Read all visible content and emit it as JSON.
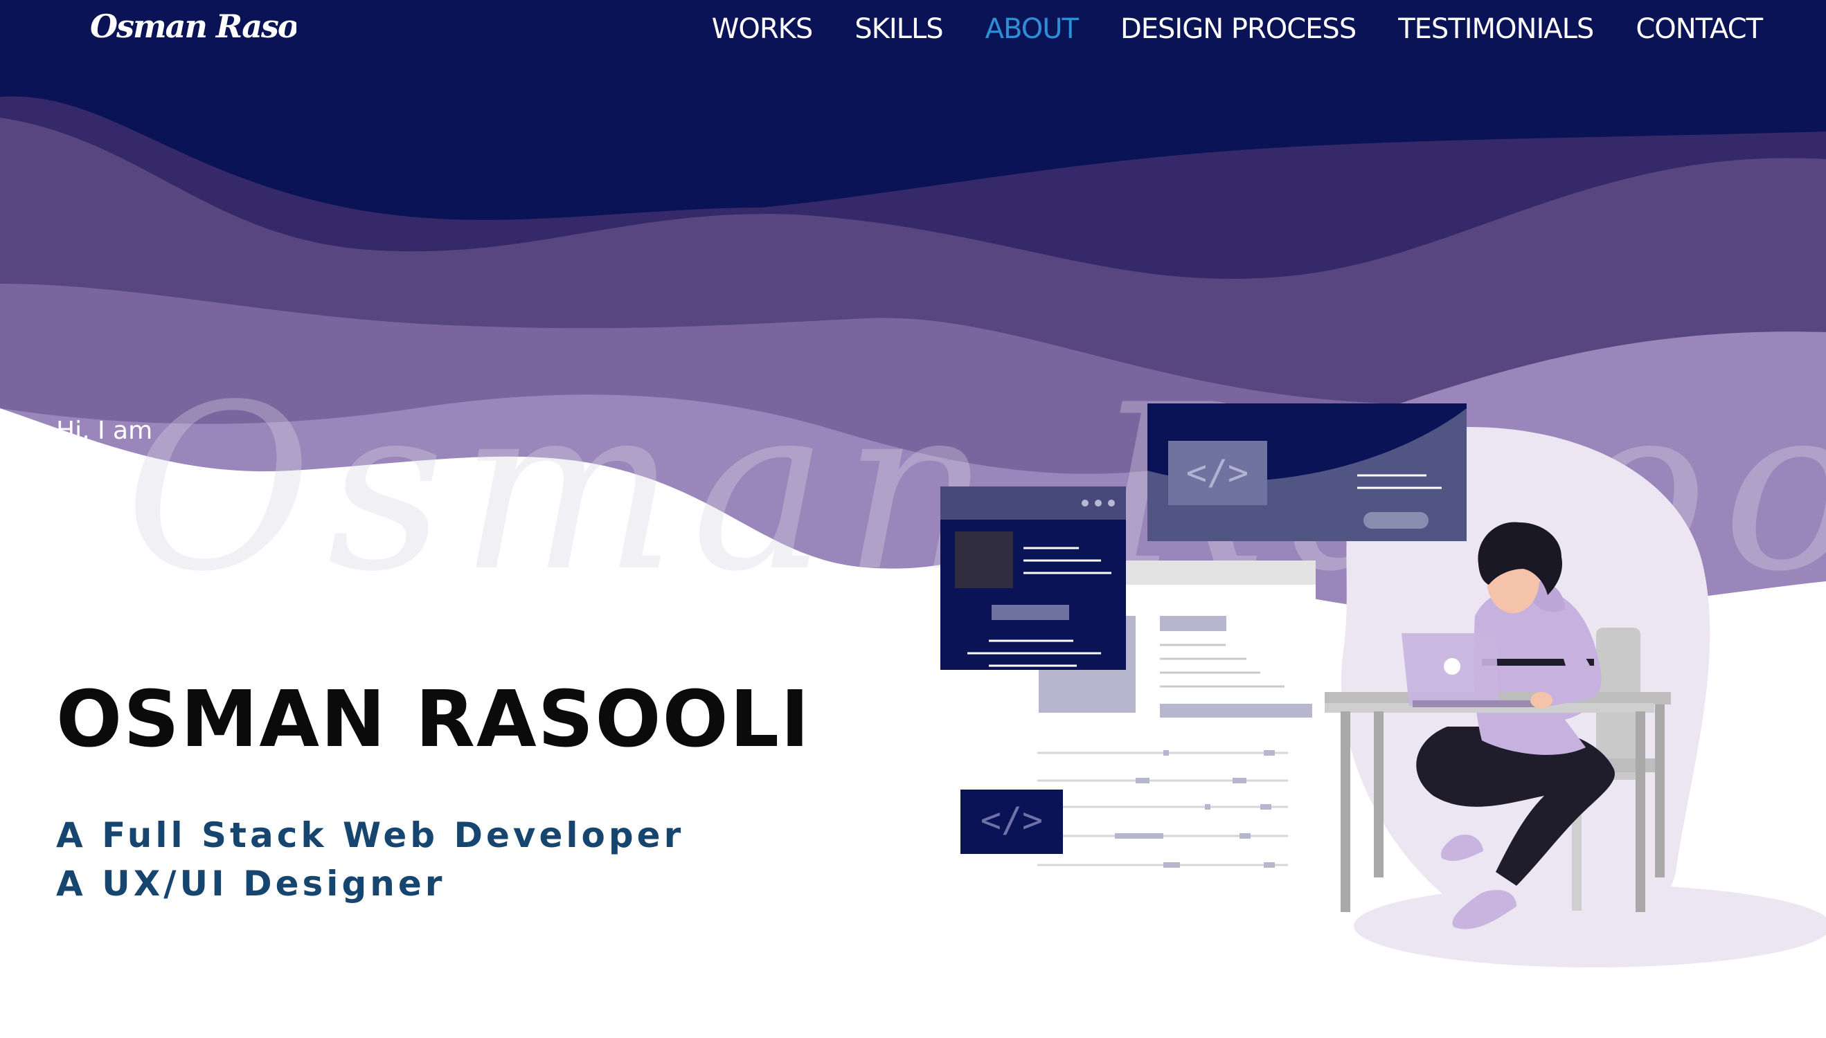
{
  "header": {
    "logo_text": "Osman Rasooli",
    "nav": [
      {
        "label": "WORKS",
        "active": false
      },
      {
        "label": "SKILLS",
        "active": false
      },
      {
        "label": "ABOUT",
        "active": true
      },
      {
        "label": "DESIGN PROCESS",
        "active": false
      },
      {
        "label": "TESTIMONIALS",
        "active": false
      },
      {
        "label": "CONTACT",
        "active": false
      }
    ]
  },
  "hero": {
    "greeting": "Hi, I am",
    "name": "OSMAN RASOOLI",
    "roles": [
      "A Full Stack Web Developer",
      "A UX/UI Designer"
    ],
    "watermark_text": "Osman Rasooli"
  },
  "colors": {
    "navy": "#0b1357",
    "wave_dark": "#36296a",
    "wave_mid": "#57467f",
    "wave_light": "#7a659f",
    "wave_pale": "#9a86ba",
    "accent_nav": "#2f8fd6",
    "role_text": "#16466f"
  },
  "icons": [
    "code-icon",
    "window-dots-icon",
    "developer-illustration"
  ]
}
